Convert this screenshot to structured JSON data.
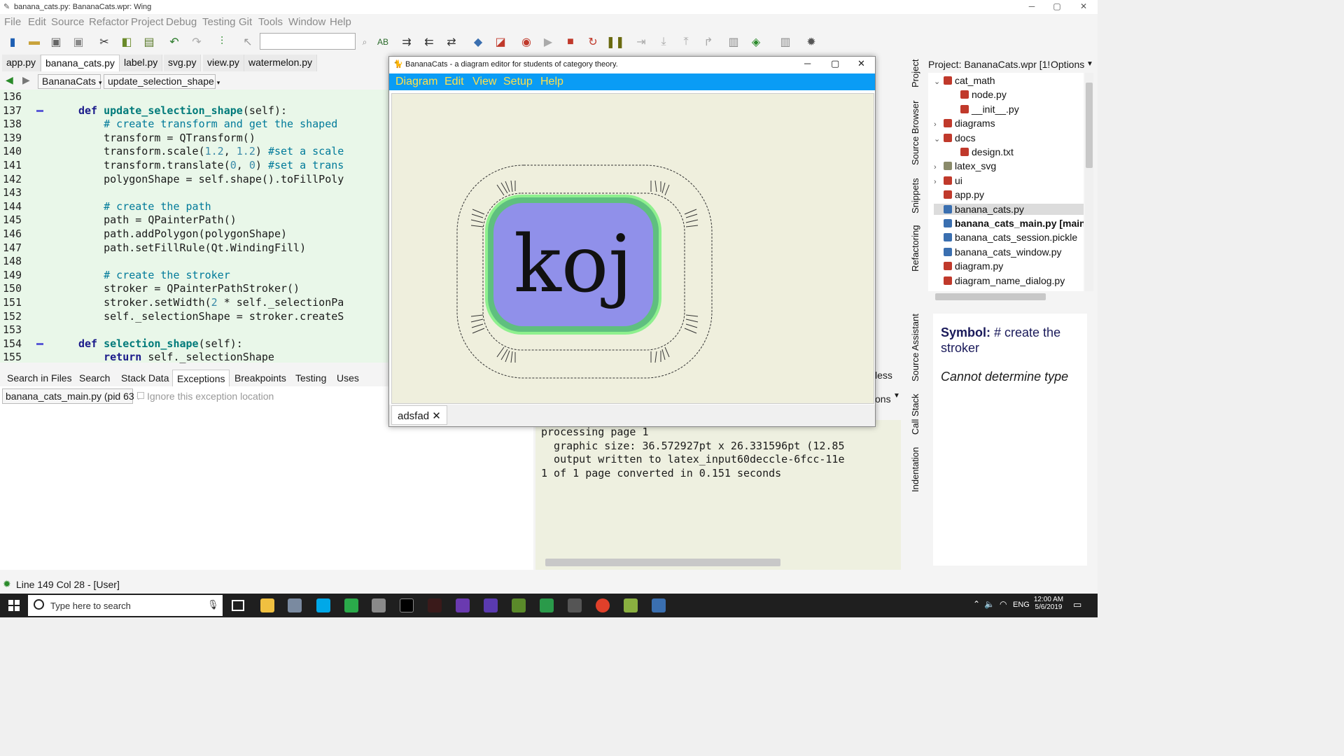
{
  "window": {
    "title": "banana_cats.py: BananaCats.wpr: Wing",
    "minimize": "─",
    "maximize": "▢",
    "close": "✕"
  },
  "menu": [
    "File",
    "Edit",
    "Source",
    "Refactor",
    "Project",
    "Debug",
    "Testing",
    "Git",
    "Tools",
    "Window",
    "Help"
  ],
  "editor_tabs": [
    "app.py",
    "banana_cats.py",
    "label.py",
    "svg.py",
    "view.py",
    "watermelon.py"
  ],
  "editor_nav": {
    "module": "BananaCats",
    "function": "update_selection_shape"
  },
  "code_lines": [
    {
      "n": "136",
      "html": ""
    },
    {
      "n": "137",
      "html": "<span class='kw'>def</span> <span class='fn'>update_selection_shape</span>(self):"
    },
    {
      "n": "138",
      "html": "    <span class='cm'># create transform and get the shaped</span>"
    },
    {
      "n": "139",
      "html": "    transform = QTransform()"
    },
    {
      "n": "140",
      "html": "    transform.scale(<span class='nm'>1.2</span>, <span class='nm'>1.2</span>) <span class='cm'>#set a scale</span>"
    },
    {
      "n": "141",
      "html": "    transform.translate(<span class='nm'>0</span>, <span class='nm'>0</span>) <span class='cm'>#set a trans</span>"
    },
    {
      "n": "142",
      "html": "    polygonShape = self.shape().toFillPoly"
    },
    {
      "n": "143",
      "html": ""
    },
    {
      "n": "144",
      "html": "    <span class='cm'># create the path</span>"
    },
    {
      "n": "145",
      "html": "    path = QPainterPath()"
    },
    {
      "n": "146",
      "html": "    path.addPolygon(polygonShape)"
    },
    {
      "n": "147",
      "html": "    path.setFillRule(Qt.WindingFill)"
    },
    {
      "n": "148",
      "html": ""
    },
    {
      "n": "149",
      "html": "    <span class='cm'># create the stroker</span>"
    },
    {
      "n": "150",
      "html": "    stroker = QPainterPathStroker()"
    },
    {
      "n": "151",
      "html": "    stroker.setWidth(<span class='nm'>2</span> * self._selectionPa"
    },
    {
      "n": "152",
      "html": "    self._selectionShape = stroker.createS"
    },
    {
      "n": "153",
      "html": ""
    },
    {
      "n": "154",
      "html": "<span class='kw'>def</span> <span class='fn'>selection_shape</span>(self):"
    },
    {
      "n": "155",
      "html": "    <span class='kw'>return</span> self._selectionShape"
    }
  ],
  "bottom_tabs": [
    "Search in Files",
    "Search",
    "Stack Data",
    "Exceptions",
    "Breakpoints",
    "Testing",
    "Uses"
  ],
  "exception": {
    "process": "banana_cats_main.py (pid 63",
    "ignore_label": "Ignore this exception location"
  },
  "output_lines": [
    "processing page 1",
    "  graphic size: 36.572927pt x 26.331596pt (12.85",
    "  output written to latex_input60deccle-6fcc-11e",
    "1 of 1 page converted in 0.151 seconds"
  ],
  "output_partial": {
    "tab": "less",
    "options": "ons"
  },
  "status": {
    "text": "Line 149 Col 28 - [User]"
  },
  "project_panel": {
    "title": "Project: BananaCats.wpr [1!",
    "options": "Options",
    "tree": [
      {
        "label": "cat_math",
        "indent": 0,
        "arrow": "⌄",
        "color": "#c0392b",
        "bold": false
      },
      {
        "label": "node.py",
        "indent": 1,
        "arrow": "",
        "color": "#c0392b",
        "bold": false
      },
      {
        "label": "__init__.py",
        "indent": 1,
        "arrow": "",
        "color": "#c0392b",
        "bold": false
      },
      {
        "label": "diagrams",
        "indent": 0,
        "arrow": "›",
        "color": "#c0392b",
        "bold": false
      },
      {
        "label": "docs",
        "indent": 0,
        "arrow": "⌄",
        "color": "#c0392b",
        "bold": false
      },
      {
        "label": "design.txt",
        "indent": 1,
        "arrow": "",
        "color": "#c0392b",
        "bold": false
      },
      {
        "label": "latex_svg",
        "indent": 0,
        "arrow": "›",
        "color": "#8a8a6a",
        "bold": false
      },
      {
        "label": "ui",
        "indent": 0,
        "arrow": "›",
        "color": "#c0392b",
        "bold": false
      },
      {
        "label": "app.py",
        "indent": 0,
        "arrow": "",
        "color": "#c0392b",
        "bold": false
      },
      {
        "label": "banana_cats.py",
        "indent": 0,
        "arrow": "",
        "color": "#3a6fb0",
        "bold": false,
        "selected": true
      },
      {
        "label": "banana_cats_main.py  [main c",
        "indent": 0,
        "arrow": "",
        "color": "#3a6fb0",
        "bold": true
      },
      {
        "label": "banana_cats_session.pickle",
        "indent": 0,
        "arrow": "",
        "color": "#3a6fb0",
        "bold": false
      },
      {
        "label": "banana_cats_window.py",
        "indent": 0,
        "arrow": "",
        "color": "#3a6fb0",
        "bold": false
      },
      {
        "label": "diagram.py",
        "indent": 0,
        "arrow": "",
        "color": "#c0392b",
        "bold": false
      },
      {
        "label": "diagram_name_dialog.py",
        "indent": 0,
        "arrow": "",
        "color": "#c0392b",
        "bold": false
      }
    ]
  },
  "side_tabs_top": [
    "Project",
    "Source Browser",
    "Snippets",
    "Refactoring"
  ],
  "side_tabs_bottom": [
    "Source Assistant",
    "Call Stack",
    "Indentation"
  ],
  "source_assistant": {
    "symbol_label": "Symbol:",
    "symbol_value": " # create the stroker",
    "type_text": "Cannot determine type"
  },
  "dialog": {
    "title": "BananaCats - a diagram editor for students of category theory.",
    "menu": [
      "Diagram",
      "Edit",
      "View",
      "Setup",
      "Help"
    ],
    "node_label": "koj",
    "tab": "adsfad",
    "tab_close": "✕",
    "colors": {
      "menubar": "#0a9cf5",
      "menu_text": "#ffe14a",
      "node_fill": "#9090ea",
      "node_ring": "#5fbf7f",
      "node_glow": "#8ef08e",
      "canvas": "#efefdd"
    }
  },
  "taskbar": {
    "search_placeholder": "Type here to search",
    "time": "12:00 AM",
    "date": "5/6/2019",
    "lang": "ENG"
  }
}
